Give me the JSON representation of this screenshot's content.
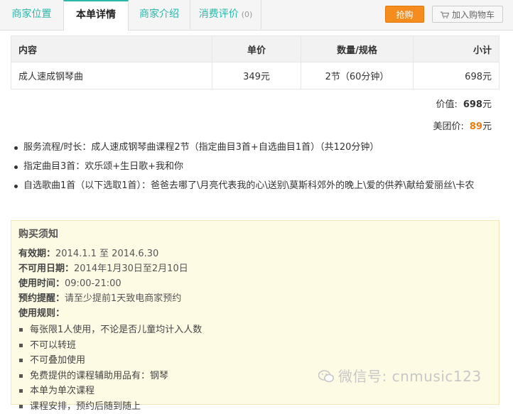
{
  "tabs": [
    {
      "label": "商家位置"
    },
    {
      "label": "本单详情"
    },
    {
      "label": "商家介绍"
    },
    {
      "label": "消费评价",
      "count": "(0)"
    }
  ],
  "actions": {
    "buy": "抢购",
    "cart": "加入购物车"
  },
  "table": {
    "headers": [
      "内容",
      "单价",
      "数量/规格",
      "小计"
    ],
    "rows": [
      [
        "成人速成钢琴曲",
        "349元",
        "2节（60分钟）",
        "698元"
      ]
    ]
  },
  "summary": {
    "value_label": "价值:",
    "value_num": "698",
    "value_unit": "元",
    "price_label": "美团价:",
    "price_num": "89",
    "price_unit": "元"
  },
  "details": [
    "服务流程/时长：成人速成钢琴曲课程2节（指定曲目3首+自选曲目1首）（共120分钟）",
    "指定曲目3首：欢乐颂+生日歌+我和你",
    "自选歌曲1首（以下选取1首）：爸爸去哪了\\月亮代表我的心\\送别\\莫斯科郊外的晚上\\爱的供养\\献给爱丽丝\\卡农"
  ],
  "notice": {
    "title": "购买须知",
    "lines": [
      {
        "label": "有效期：",
        "value": "2014.1.1 至 2014.6.30"
      },
      {
        "label": "不可用日期：",
        "value": "2014年1月30日至2月10日"
      },
      {
        "label": "使用时间：",
        "value": "09:00-21:00"
      },
      {
        "label": "预约提醒：",
        "value": "请至少提前1天致电商家预约"
      }
    ],
    "rules_label": "使用规则：",
    "rules": [
      "每张限1人使用，不论是否儿童均计入人数",
      "不可以转班",
      "不可叠加使用",
      "免费提供的课程辅助用品有：钢琴",
      "本单为单次课程",
      "课程安排，预约后随到随上"
    ]
  },
  "watermark": "微信号: cnmusic123",
  "colors": {
    "accent": "#2bb8aa",
    "buy": "#f58d1e",
    "price": "#f07a12",
    "notice_bg": "#fefbe5"
  }
}
